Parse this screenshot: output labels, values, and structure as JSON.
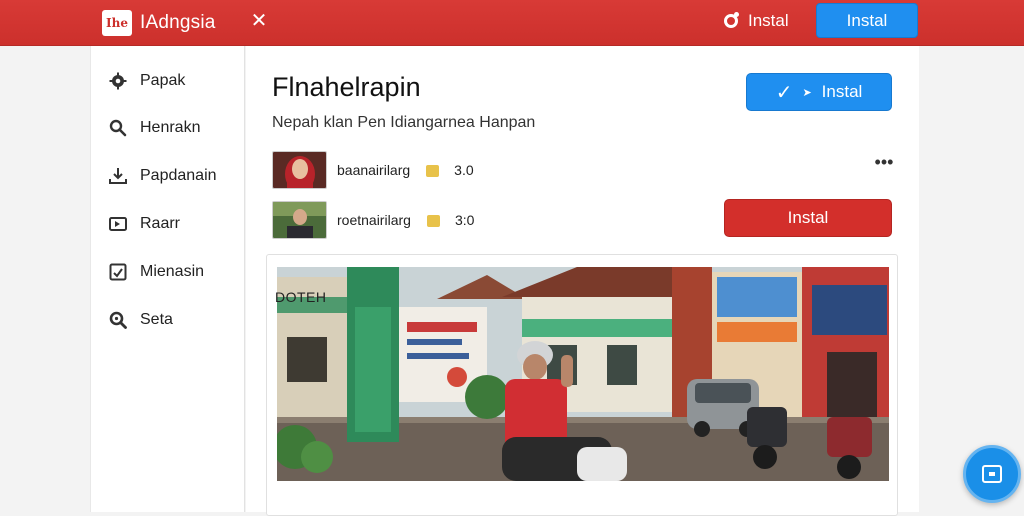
{
  "topbar": {
    "brand_logo_text": "Ihe",
    "brand_name": "IAdngsia",
    "close_glyph": "✕",
    "link_label": "Instal",
    "button_label": "Instal"
  },
  "sidebar": {
    "items": [
      {
        "label": "Papak",
        "icon": "gear-icon"
      },
      {
        "label": "Henrakn",
        "icon": "search-icon"
      },
      {
        "label": "Papdanain",
        "icon": "download-icon"
      },
      {
        "label": "Raarr",
        "icon": "video-icon"
      },
      {
        "label": "Mienasin",
        "icon": "box-icon"
      },
      {
        "label": "Seta",
        "icon": "search-settings-icon"
      }
    ]
  },
  "main": {
    "title": "Flnahelrapin",
    "subtitle": "Nepah klan Pen Idiangarnea Hanpan",
    "primary_button": {
      "label": "Instal",
      "check": "✓",
      "arrow": "➤"
    },
    "rows": [
      {
        "text": "baanairilarg",
        "badge": "P",
        "rating": "3.0"
      },
      {
        "text": "roetnairilarg",
        "badge": "",
        "rating": "3:0"
      }
    ],
    "more": "•••",
    "red_button": "Instal",
    "card": {
      "footer_label": "DOTEH"
    }
  },
  "colors": {
    "topbar": "#cc302c",
    "accent_blue": "#1f8ff0",
    "accent_red": "#d32f2b"
  }
}
